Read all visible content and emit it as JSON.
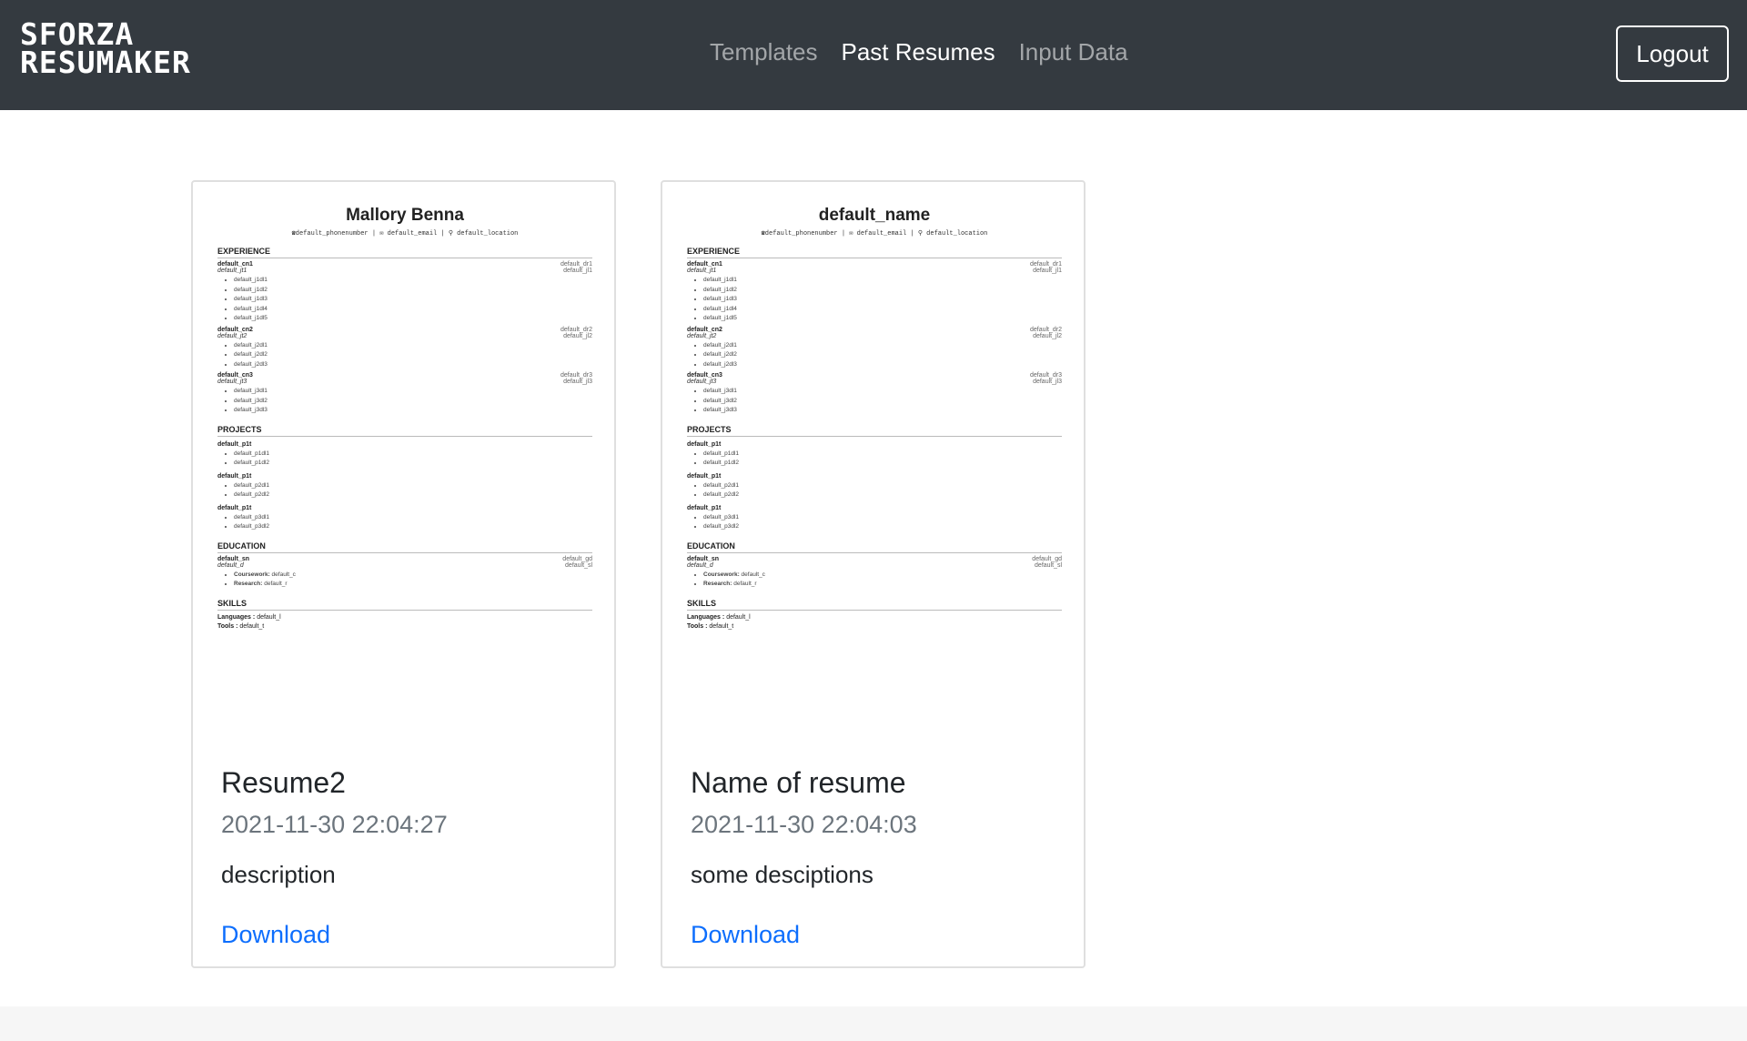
{
  "brand": {
    "line1": "SFORZA",
    "line2": "RESUMAKER"
  },
  "nav": {
    "templates": "Templates",
    "past_resumes": "Past Resumes",
    "input_data": "Input Data"
  },
  "logout_label": "Logout",
  "cards": [
    {
      "title": "Resume2",
      "date": "2021-11-30 22:04:27",
      "description": "description",
      "link": "Download",
      "preview": {
        "name": "Mallory Benna"
      }
    },
    {
      "title": "Name of resume",
      "date": "2021-11-30 22:04:03",
      "description": "some desciptions",
      "link": "Download",
      "preview": {
        "name": "default_name"
      }
    }
  ],
  "preview_common": {
    "contact": "☎default_phonenumber | ✉ default_email | ⚲ default_location",
    "sections": {
      "experience": "EXPERIENCE",
      "projects": "PROJECTS",
      "education": "EDUCATION",
      "skills": "SKILLS"
    },
    "jobs": [
      {
        "company": "default_cn1",
        "dates": "default_dr1",
        "title": "default_jt1",
        "loc": "default_jl1",
        "items": [
          "default_j1dl1",
          "default_j1dl2",
          "default_j1dl3",
          "default_j1dl4",
          "default_j1dl5"
        ]
      },
      {
        "company": "default_cn2",
        "dates": "default_dr2",
        "title": "default_jt2",
        "loc": "default_jl2",
        "items": [
          "default_j2dl1",
          "default_j2dl2",
          "default_j2dl3"
        ]
      },
      {
        "company": "default_cn3",
        "dates": "default_dr3",
        "title": "default_jt3",
        "loc": "default_jl3",
        "items": [
          "default_j3dl1",
          "default_j3dl2",
          "default_j3dl3"
        ]
      }
    ],
    "projects": [
      {
        "title": "default_p1t",
        "items": [
          "default_p1dl1",
          "default_p1dl2"
        ]
      },
      {
        "title": "default_p1t",
        "items": [
          "default_p2dl1",
          "default_p2dl2"
        ]
      },
      {
        "title": "default_p1t",
        "items": [
          "default_p3dl1",
          "default_p3dl2"
        ]
      }
    ],
    "education": {
      "school": "default_sn",
      "grad": "default_gd",
      "degree": "default_d",
      "loc": "default_sl",
      "coursework_label": "Coursework:",
      "coursework": "default_c",
      "research_label": "Research:",
      "research": "default_r"
    },
    "skills": {
      "languages_label": "Languages :",
      "languages": "default_l",
      "tools_label": "Tools :",
      "tools": "default_t"
    }
  }
}
